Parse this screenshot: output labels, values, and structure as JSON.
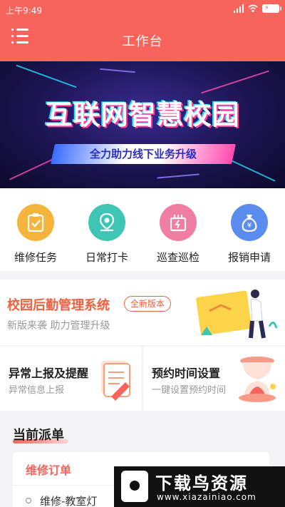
{
  "status_bar": {
    "time": "上午9:49",
    "battery": "⚡"
  },
  "header": {
    "title": "工作台"
  },
  "banner": {
    "title": "互联网智慧校园",
    "slogan": "全力助力线下业务升级"
  },
  "actions": [
    {
      "label": "维修任务",
      "icon": "clipboard-check-icon",
      "color": "#f5b43c"
    },
    {
      "label": "日常打卡",
      "icon": "location-pin-icon",
      "color": "#3fc5b5"
    },
    {
      "label": "巡查巡检",
      "icon": "inspection-device-icon",
      "color": "#f07ea0"
    },
    {
      "label": "报销申请",
      "icon": "money-bag-icon",
      "color": "#5b8cf0"
    }
  ],
  "promo": {
    "title": "校园后勤管理系统",
    "tag": "全新版本",
    "subtitle": "新版来袭 助力管理升级"
  },
  "cards": [
    {
      "title": "异常上报及提醒",
      "subtitle": "异常信息上报"
    },
    {
      "title": "预约时间设置",
      "subtitle": "一键设置预约时间"
    }
  ],
  "dispatch": {
    "section_title": "当前派单",
    "order_title": "维修订单",
    "order_item": "维修-教室灯"
  },
  "watermark": {
    "title": "下载鸟资源",
    "url": "www.xiazainiao.com"
  },
  "colors": {
    "accent": "#f6645c",
    "promo": "#f0613f"
  }
}
